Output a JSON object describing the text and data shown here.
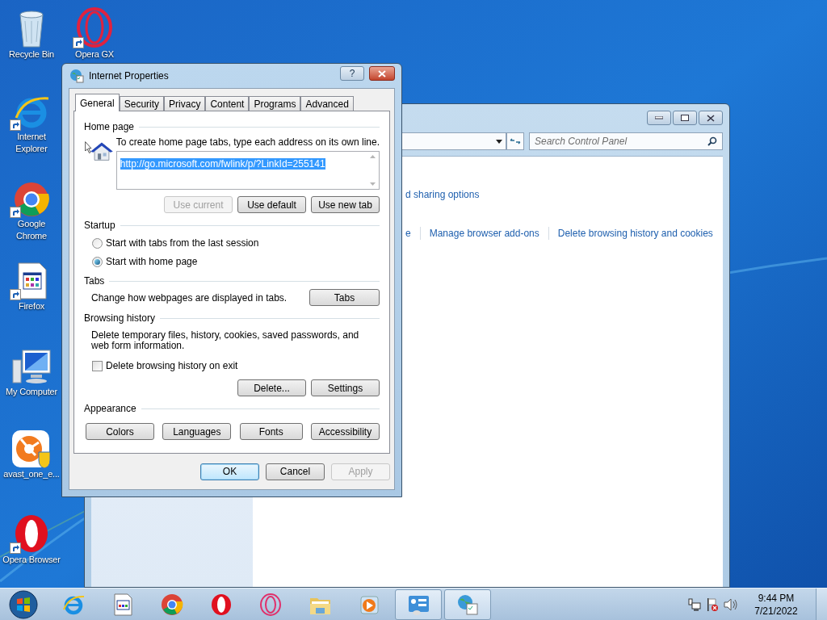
{
  "desktop_icons": [
    {
      "label": "Recycle Bin",
      "shortcut": false
    },
    {
      "label": "Opera GX",
      "shortcut": true
    },
    {
      "label": "Internet Explorer",
      "shortcut": true
    },
    {
      "label": "Google Chrome",
      "shortcut": true
    },
    {
      "label": "Firefox",
      "shortcut": true
    },
    {
      "label": "My Computer",
      "shortcut": false
    },
    {
      "label": "avast_one_e...",
      "shortcut": false
    },
    {
      "label": "Opera Browser",
      "shortcut": true
    }
  ],
  "control_panel": {
    "search": {
      "placeholder": "Search Control Panel"
    },
    "links": [
      {
        "text": "d sharing options"
      }
    ],
    "link_row": [
      {
        "text": "e"
      },
      {
        "text": "Manage browser add-ons"
      },
      {
        "text": "Delete browsing history and cookies"
      }
    ]
  },
  "dialog": {
    "title": "Internet Properties",
    "help": "?",
    "tabs": [
      {
        "label": "General",
        "selected": true
      },
      {
        "label": "Security",
        "selected": false
      },
      {
        "label": "Privacy",
        "selected": false
      },
      {
        "label": "Content",
        "selected": false
      },
      {
        "label": "Programs",
        "selected": false
      },
      {
        "label": "Advanced",
        "selected": false
      }
    ],
    "home_page": {
      "heading": "Home page",
      "instruction": "To create home page tabs, type each address on its own line.",
      "address": "http://go.microsoft.com/fwlink/p/?LinkId=255141",
      "address_selected": true,
      "buttons": [
        {
          "label": "Use current",
          "disabled": true
        },
        {
          "label": "Use default",
          "disabled": false
        },
        {
          "label": "Use new tab",
          "disabled": false
        }
      ]
    },
    "startup": {
      "heading": "Startup",
      "options": [
        {
          "label": "Start with tabs from the last session",
          "selected": false
        },
        {
          "label": "Start with home page",
          "selected": true
        }
      ]
    },
    "tabs_section": {
      "heading": "Tabs",
      "description": "Change how webpages are displayed in tabs.",
      "button": "Tabs"
    },
    "browsing_history": {
      "heading": "Browsing history",
      "description": "Delete temporary files, history, cookies, saved passwords, and web form information.",
      "checkbox": {
        "label": "Delete browsing history on exit",
        "checked": false
      },
      "buttons": [
        {
          "label": "Delete...",
          "disabled": false
        },
        {
          "label": "Settings",
          "disabled": false
        }
      ]
    },
    "appearance": {
      "heading": "Appearance",
      "buttons": [
        {
          "label": "Colors",
          "disabled": false
        },
        {
          "label": "Languages",
          "disabled": false
        },
        {
          "label": "Fonts",
          "disabled": false
        },
        {
          "label": "Accessibility",
          "disabled": false
        }
      ]
    },
    "footer": [
      {
        "label": "OK",
        "disabled": false,
        "default": true
      },
      {
        "label": "Cancel",
        "disabled": false,
        "default": false
      },
      {
        "label": "Apply",
        "disabled": true,
        "default": false
      }
    ]
  },
  "taskbar": {
    "items": [
      {
        "selected": false
      },
      {
        "selected": false
      },
      {
        "selected": false
      },
      {
        "selected": false
      },
      {
        "selected": false
      },
      {
        "selected": false
      },
      {
        "selected": false
      },
      {
        "selected": true
      },
      {
        "selected": true
      }
    ],
    "time": "9:44 PM",
    "date": "7/21/2022"
  }
}
